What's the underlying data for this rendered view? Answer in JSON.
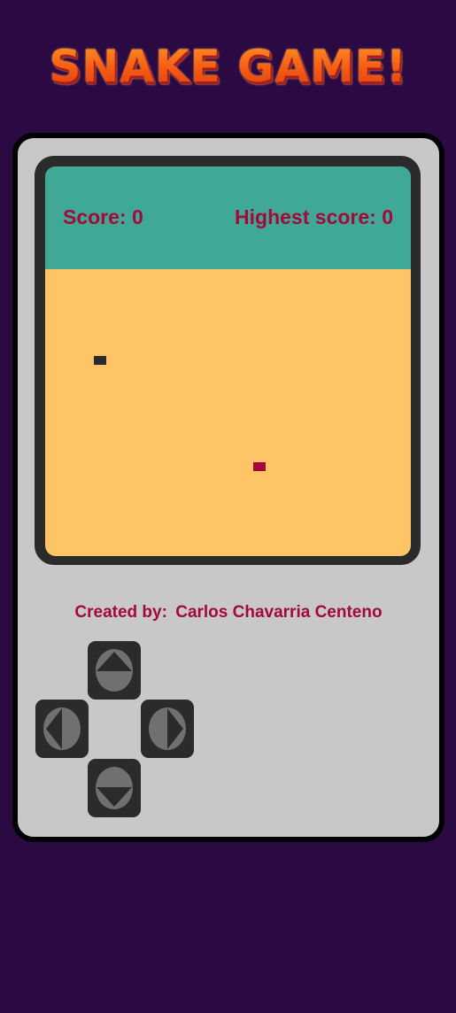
{
  "title": "SNAKE GAME!",
  "scoreboard": {
    "score_text": "Score: 0",
    "highest_text": "Highest score: 0"
  },
  "game": {
    "snake": [
      {
        "col": 4,
        "row": 10
      }
    ],
    "food": {
      "col": 17,
      "row": 22
    }
  },
  "credits": {
    "label": "Created by:",
    "author": "Carlos Chavarria Centeno"
  },
  "dpad": {
    "up_icon": "up-arrow-icon",
    "down_icon": "down-arrow-icon",
    "left_icon": "left-arrow-icon",
    "right_icon": "right-arrow-icon"
  },
  "colors": {
    "background": "#2b0a44",
    "console": "#c8c8c8",
    "scorebar": "#3fa896",
    "playfield": "#ffc466",
    "snake": "#2b2b2b",
    "food": "#a3093a",
    "text": "#a3093a"
  }
}
